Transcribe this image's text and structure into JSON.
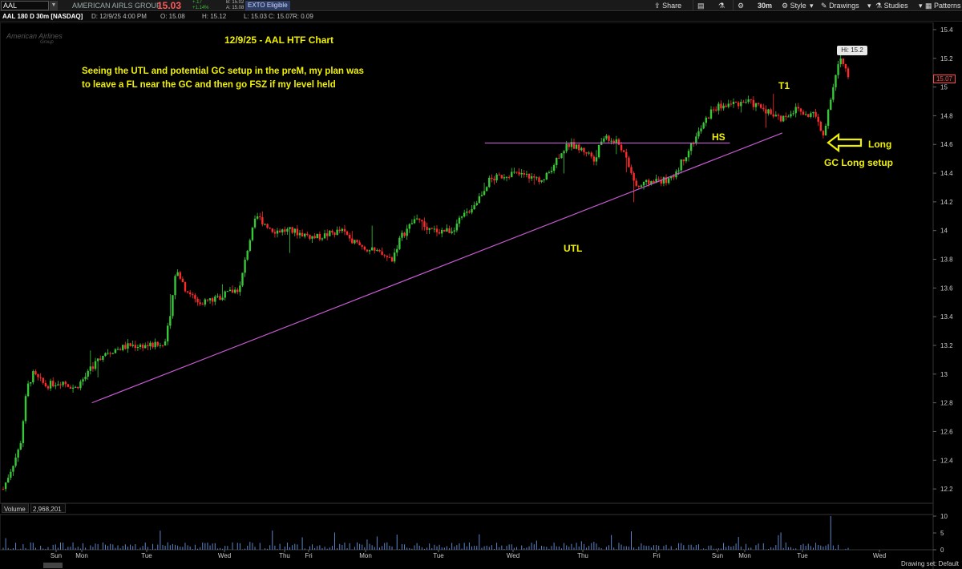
{
  "toolbar": {
    "symbol": "AAL",
    "company_name": "AMERICAN AIRLS GROUP",
    "last_price": "15.03",
    "change_abs": "+.17",
    "change_pct": "+1.14%",
    "bid": "B: 15.02",
    "ask": "A: 15.08",
    "exto_label": "EXTO Eligible",
    "share_label": "Share",
    "timeframe_label": "30m",
    "style_label": "Style",
    "drawings_label": "Drawings",
    "studies_label": "Studies",
    "patterns_label": "Patterns"
  },
  "header": {
    "chart_desc": "AAL 180 D 30m [NASDAQ]",
    "date": "D: 12/9/25 4:00 PM",
    "open": "O: 15.08",
    "high": "H: 15.12",
    "low": "L: 15.03",
    "close": "C: 15.07",
    "range": "R: 0.09"
  },
  "logo": {
    "line1": "American Airlines",
    "line2": "Group"
  },
  "annotations": {
    "title": "12/9/25 - AAL HTF Chart",
    "plan": "Seeing the UTL and potential GC setup in the preM, my plan was to leave a FL near the GC and then go FSZ if my level held",
    "utl": "UTL",
    "hs": "HS",
    "t1": "T1",
    "long": "Long",
    "gc_setup": "GC Long setup"
  },
  "badges": {
    "hi": "Hi: 15.2",
    "current_price": "15.07"
  },
  "volume": {
    "label": "Volume",
    "value": "2,968,201",
    "axis_ticks": [
      "10",
      "5",
      "0"
    ]
  },
  "status": {
    "drawing_set": "Drawing set: Default"
  },
  "colors": {
    "up": "#37c837",
    "down": "#ff2a2a",
    "trendline": "#c55bd0",
    "annotation": "#f0f000",
    "volume": "#5b86c8"
  },
  "chart_data": {
    "type": "candlestick",
    "symbol": "AAL",
    "interval": "30m",
    "ylim": [
      12.1,
      15.45
    ],
    "price_ticks": [
      15.4,
      15.2,
      15,
      14.8,
      14.6,
      14.4,
      14.2,
      14,
      13.8,
      13.6,
      13.4,
      13.2,
      13,
      12.8,
      12.6,
      12.4,
      12.2
    ],
    "x_ticks": [
      "Sun",
      "Mon",
      "Tue",
      "Wed",
      "Thu",
      "Fri",
      "Mon",
      "Tue",
      "Wed",
      "Thu",
      "Fri",
      "Sun",
      "Mon",
      "Tue",
      "Wed"
    ],
    "path_x": [
      0,
      0.02,
      0.028,
      0.035,
      0.05,
      0.07,
      0.085,
      0.1,
      0.105,
      0.12,
      0.15,
      0.19,
      0.2,
      0.205,
      0.215,
      0.23,
      0.25,
      0.28,
      0.29,
      0.3,
      0.32,
      0.34,
      0.37,
      0.4,
      0.42,
      0.44,
      0.46,
      0.47,
      0.49,
      0.5,
      0.53,
      0.56,
      0.575,
      0.6,
      0.62,
      0.64,
      0.66,
      0.67,
      0.69,
      0.7,
      0.71,
      0.73,
      0.75,
      0.77,
      0.79,
      0.8,
      0.82,
      0.84,
      0.86,
      0.88,
      0.9,
      0.92,
      0.94,
      0.95,
      0.96,
      0.97,
      0.98,
      0.99,
      1.0
    ],
    "path_price": [
      12.2,
      12.5,
      12.9,
      13.0,
      12.92,
      12.95,
      12.9,
      13.0,
      13.05,
      13.15,
      13.2,
      13.2,
      13.5,
      13.75,
      13.6,
      13.5,
      13.52,
      13.6,
      13.9,
      14.1,
      14.0,
      14.0,
      13.95,
      14.0,
      13.9,
      13.85,
      13.8,
      13.95,
      14.1,
      14.0,
      14.0,
      14.2,
      14.35,
      14.4,
      14.38,
      14.35,
      14.55,
      14.6,
      14.55,
      14.5,
      14.65,
      14.6,
      14.3,
      14.35,
      14.35,
      14.45,
      14.65,
      14.85,
      14.88,
      14.9,
      14.85,
      14.78,
      14.85,
      14.8,
      14.82,
      14.65,
      14.95,
      15.2,
      15.07
    ],
    "series": [
      {
        "name": "UTL",
        "x": [
          0.105,
          0.922
        ],
        "y": [
          12.8,
          14.68
        ]
      },
      {
        "name": "HS",
        "x": [
          0.57,
          0.86
        ],
        "y": [
          14.61,
          14.61
        ]
      }
    ],
    "volume_max": 10
  }
}
